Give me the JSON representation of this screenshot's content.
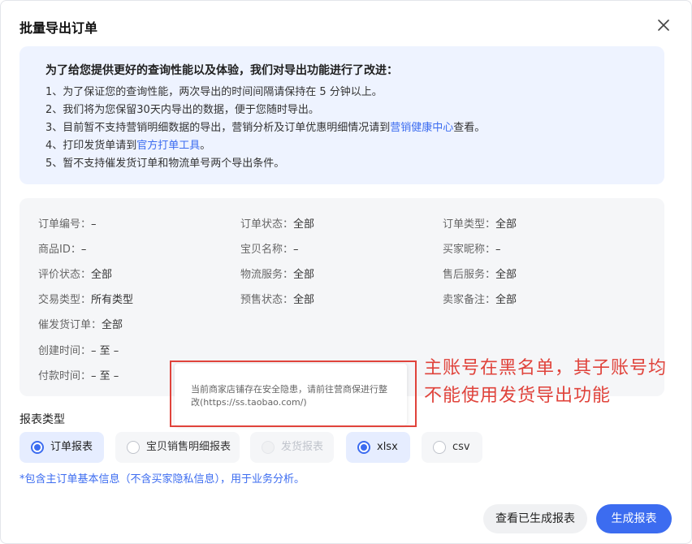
{
  "dialog": {
    "title": "批量导出订单",
    "close_icon": "close-icon"
  },
  "notice": {
    "heading": "为了给您提供更好的查询性能以及体验，我们对导出功能进行了改进：",
    "item1": "1、为了保证您的查询性能，两次导出的时间间隔请保持在 5 分钟以上。",
    "item2": "2、我们将为您保留30天内导出的数据，便于您随时导出。",
    "item3_prefix": "3、目前暂不支持营销明细数据的导出，营销分析及订单优惠明细情况请到",
    "item3_link": "营销健康中心",
    "item3_suffix": "查看。",
    "item4_prefix": "4、打印发货单请到",
    "item4_link": "官方打单工具",
    "item4_suffix": "。",
    "item5": "5、暂不支持催发货订单和物流单号两个导出条件。"
  },
  "filters": {
    "order_no": {
      "label": "订单编号：",
      "value": "–"
    },
    "order_status": {
      "label": "订单状态：",
      "value": "全部"
    },
    "order_type": {
      "label": "订单类型：",
      "value": "全部"
    },
    "item_id": {
      "label": "商品ID：",
      "value": "–"
    },
    "item_name": {
      "label": "宝贝名称：",
      "value": "–"
    },
    "buyer_nick": {
      "label": "买家昵称：",
      "value": "–"
    },
    "review_status": {
      "label": "评价状态：",
      "value": "全部"
    },
    "logistics_service": {
      "label": "物流服务：",
      "value": "全部"
    },
    "after_sales": {
      "label": "售后服务：",
      "value": "全部"
    },
    "trade_type": {
      "label": "交易类型：",
      "value": "所有类型"
    },
    "presale_status": {
      "label": "预售状态：",
      "value": "全部"
    },
    "seller_note": {
      "label": "卖家备注：",
      "value": "全部"
    },
    "urge_order": {
      "label": "催发货订单：",
      "value": "全部"
    },
    "created_time": {
      "label": "创建时间：",
      "value": "– 至 –"
    },
    "paid_time": {
      "label": "付款时间：",
      "value": "– 至 –"
    }
  },
  "report": {
    "section_label": "报表类型",
    "options": [
      "订单报表",
      "宝贝销售明细报表",
      "发货报表"
    ],
    "formats": [
      "xlsx",
      "csv"
    ],
    "selected_option": "订单报表",
    "selected_format": "xlsx",
    "note": "*包含主订单基本信息（不含买家隐私信息），用于业务分析。"
  },
  "tooltip": {
    "text": "当前商家店铺存在安全隐患，请前往营商保进行整改(https://ss.taobao.com/)"
  },
  "annotation": {
    "line1": "主账号在黑名单，其子账号均",
    "line2": "不能使用发货导出功能"
  },
  "footer": {
    "view_generated": "查看已生成报表",
    "generate": "生成报表"
  },
  "colors": {
    "accent": "#3c6cf0",
    "annotation_red": "#e0433b"
  }
}
